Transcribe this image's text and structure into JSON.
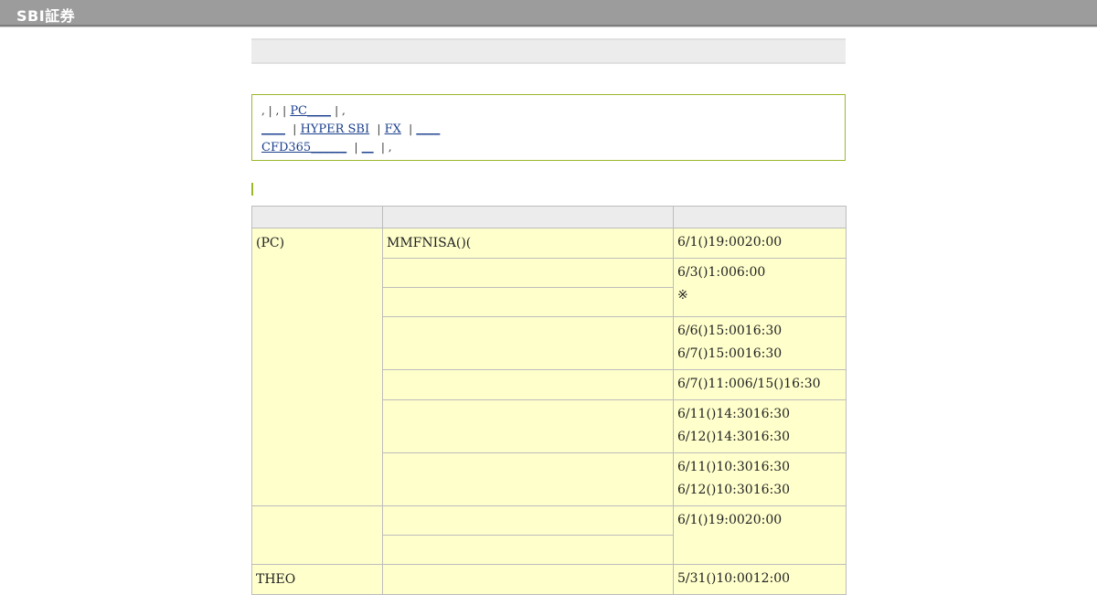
{
  "header": {
    "logo_text": "SBI証券"
  },
  "notice": {
    "line1": {
      "prefix": ", | , |",
      "link_pc": "PC____",
      "suffix": "| ,"
    },
    "line2": {
      "link_blank1": "____",
      "sep1": "|",
      "link_hyper": "HYPER SBI",
      "sep2": "|",
      "link_fx": "FX",
      "sep3": "|",
      "link_blank2": "____"
    },
    "line3": {
      "link_cfd": "CFD365______",
      "sep1": "|",
      "link_blank3": "__",
      "suffix": "| ,"
    }
  },
  "table": {
    "headers": [
      "",
      "",
      ""
    ],
    "groups": [
      {
        "category": "(PC)",
        "rows": [
          {
            "service": "MMFNISA()(",
            "time": [
              "6/1()19:0020:00"
            ]
          },
          {
            "service": "",
            "time": [
              "6/3()1:006:00",
              "※"
            ],
            "span": 2
          },
          {
            "service": "",
            "time": null
          },
          {
            "service": "",
            "time": [
              "6/6()15:0016:30",
              "6/7()15:0016:30"
            ]
          },
          {
            "service": "",
            "time": [
              "6/7()11:006/15()16:30"
            ]
          },
          {
            "service": "",
            "time": [
              "6/11()14:3016:30",
              "6/12()14:3016:30"
            ]
          },
          {
            "service": "",
            "time": [
              "6/11()10:3016:30",
              "6/12()10:3016:30"
            ]
          }
        ]
      },
      {
        "category": "",
        "rows": [
          {
            "service": "",
            "time": [
              "6/1()19:0020:00"
            ],
            "span": 2
          },
          {
            "service": "",
            "time": null
          }
        ]
      },
      {
        "category": "THEO",
        "rows": [
          {
            "service": "",
            "time": [
              "5/31()10:0012:00"
            ]
          }
        ]
      }
    ]
  }
}
